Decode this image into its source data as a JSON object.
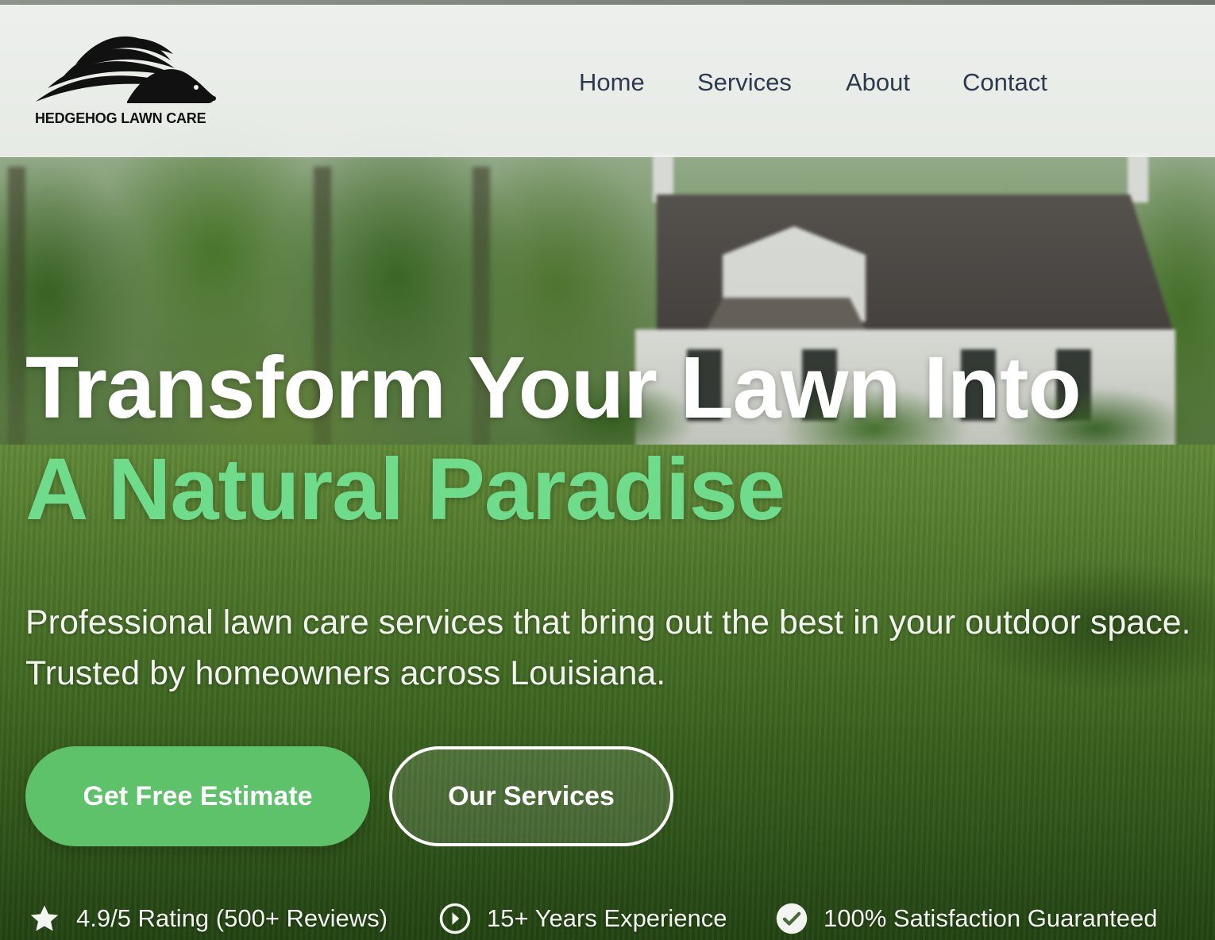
{
  "brand": {
    "name": "HEDGEHOG LAWN CARE",
    "logo_icon": "hedgehog-logo"
  },
  "nav": {
    "items": [
      {
        "label": "Home"
      },
      {
        "label": "Services"
      },
      {
        "label": "About"
      },
      {
        "label": "Contact"
      }
    ]
  },
  "hero": {
    "title_line1": "Transform Your Lawn Into",
    "title_line2": "A Natural Paradise",
    "subtitle": "Professional lawn care services that bring out the best in your outdoor space. Trusted by homeowners across Louisiana.",
    "primary_button": "Get Free Estimate",
    "secondary_button": "Our Services"
  },
  "badges": [
    {
      "icon": "star-icon",
      "text": "4.9/5 Rating (500+ Reviews)"
    },
    {
      "icon": "play-circle-icon",
      "text": "15+ Years Experience"
    },
    {
      "icon": "check-circle-icon",
      "text": "100% Satisfaction Guaranteed"
    }
  ],
  "colors": {
    "accent_green": "#6fdc8c",
    "button_green": "#5ec26b",
    "nav_text": "#2d3a4e",
    "white": "#ffffff"
  }
}
